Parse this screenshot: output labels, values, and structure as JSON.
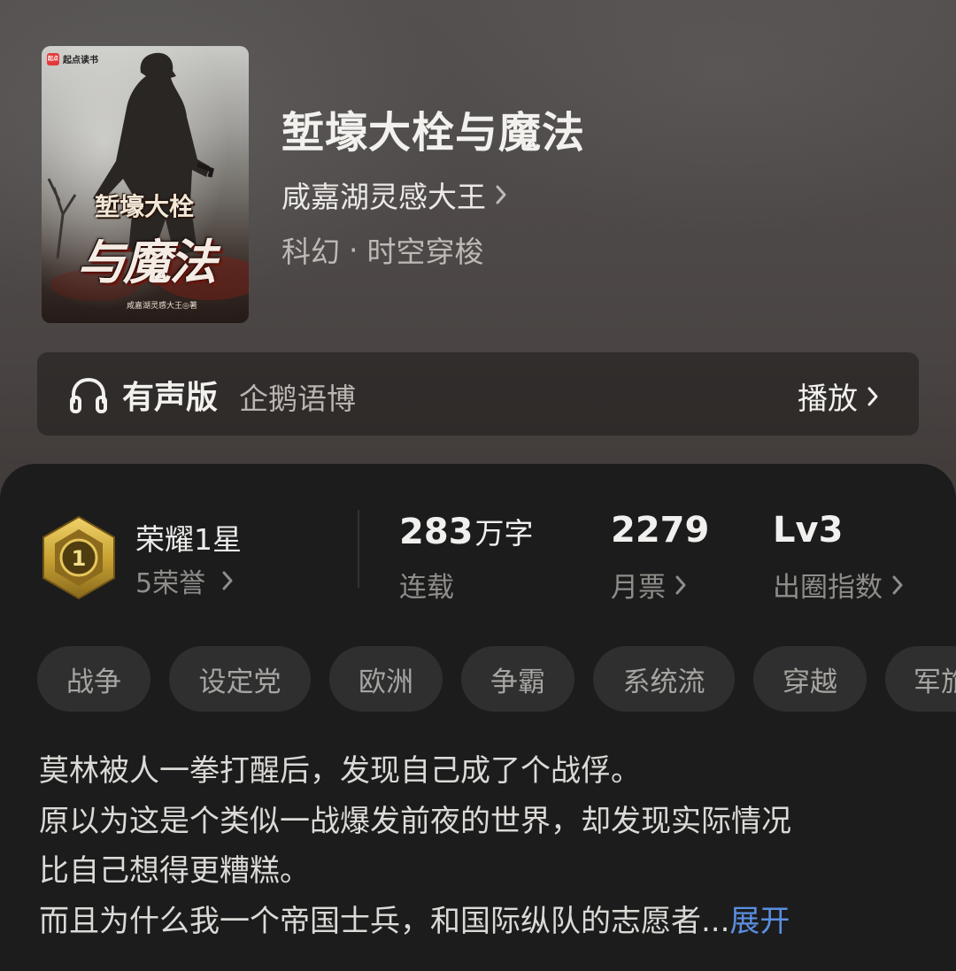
{
  "book": {
    "title": "堑壕大栓与魔法",
    "author": "咸嘉湖灵感大王",
    "category": "科幻",
    "subcategory": "时空穿梭"
  },
  "cover": {
    "brand_badge": "起点",
    "brand": "起点读书",
    "title_line1": "堑壕大栓",
    "title_line2": "与魔法",
    "author_line": "咸嘉湖灵感大王◎著"
  },
  "audio": {
    "label": "有声版",
    "provider": "企鹅语博",
    "action": "播放"
  },
  "honor": {
    "badge_number": "1",
    "level": "荣耀1星",
    "points": "5荣誉"
  },
  "stats": {
    "words": {
      "value": "283",
      "unit": "万字",
      "label": "连载"
    },
    "monthly_votes": {
      "value": "2279",
      "label": "月票"
    },
    "popularity": {
      "value": "Lv3",
      "label": "出圈指数"
    }
  },
  "tags": [
    "战争",
    "设定党",
    "欧洲",
    "争霸",
    "系统流",
    "穿越",
    "军旅"
  ],
  "description": {
    "lines": [
      "莫林被人一拳打醒后，发现自己成了个战俘。",
      "原以为这是个类似一战爆发前夜的世界，却发现实际情况",
      "比自己想得更糟糕。",
      "而且为什么我一个帝国士兵，和国际纵队的志愿者..."
    ],
    "expand": "展开"
  },
  "colors": {
    "accent_link": "#5a8fe0",
    "panel_bg": "#1c1c1c",
    "tag_bg": "#2f2f2f",
    "badge_gold": "#c9a334"
  },
  "icons": {
    "audio": "headphones-icon",
    "chevron": "chevron-right-icon",
    "badge": "honor-badge-icon"
  }
}
